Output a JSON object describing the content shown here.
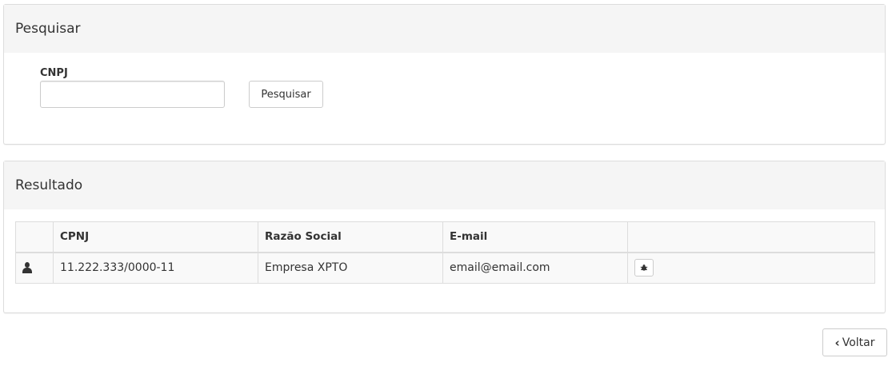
{
  "search": {
    "title": "Pesquisar",
    "cnpj_label": "CNPJ",
    "cnpj_value": "",
    "cnpj_placeholder": "",
    "button_label": "Pesquisar"
  },
  "result": {
    "title": "Resultado",
    "columns": [
      "",
      "CPNJ",
      "Razão Social",
      "E-mail",
      ""
    ],
    "rows": [
      {
        "icon": "user-icon",
        "cnpj": "11.222.333/0000-11",
        "razao_social": "Empresa XPTO",
        "email": "email@email.com",
        "action_icon": "bug-icon"
      }
    ]
  },
  "footer": {
    "back_icon": "chevron-left-icon",
    "back_label": "Voltar"
  }
}
